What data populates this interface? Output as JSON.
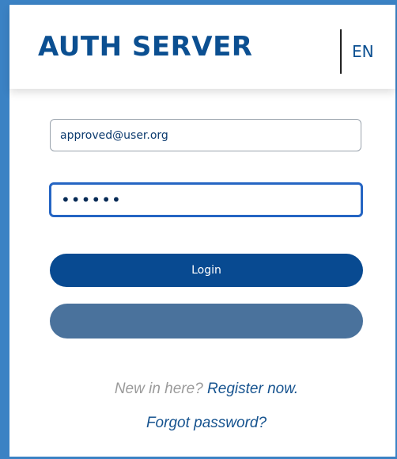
{
  "header": {
    "brand": "AUTH SERVER",
    "language": "EN"
  },
  "form": {
    "email_value": "approved@user.org",
    "password_value": "••••••",
    "login_label": "Login",
    "secondary_label": ""
  },
  "footer": {
    "register_prompt": "New in here?",
    "register_link": "Register now.",
    "forgot_link": "Forgot password?"
  },
  "colors": {
    "frame": "#3b82c4",
    "brand": "#0b4f91",
    "login_button": "#084a91",
    "secondary_button": "#4a729c",
    "link": "#16538f"
  }
}
